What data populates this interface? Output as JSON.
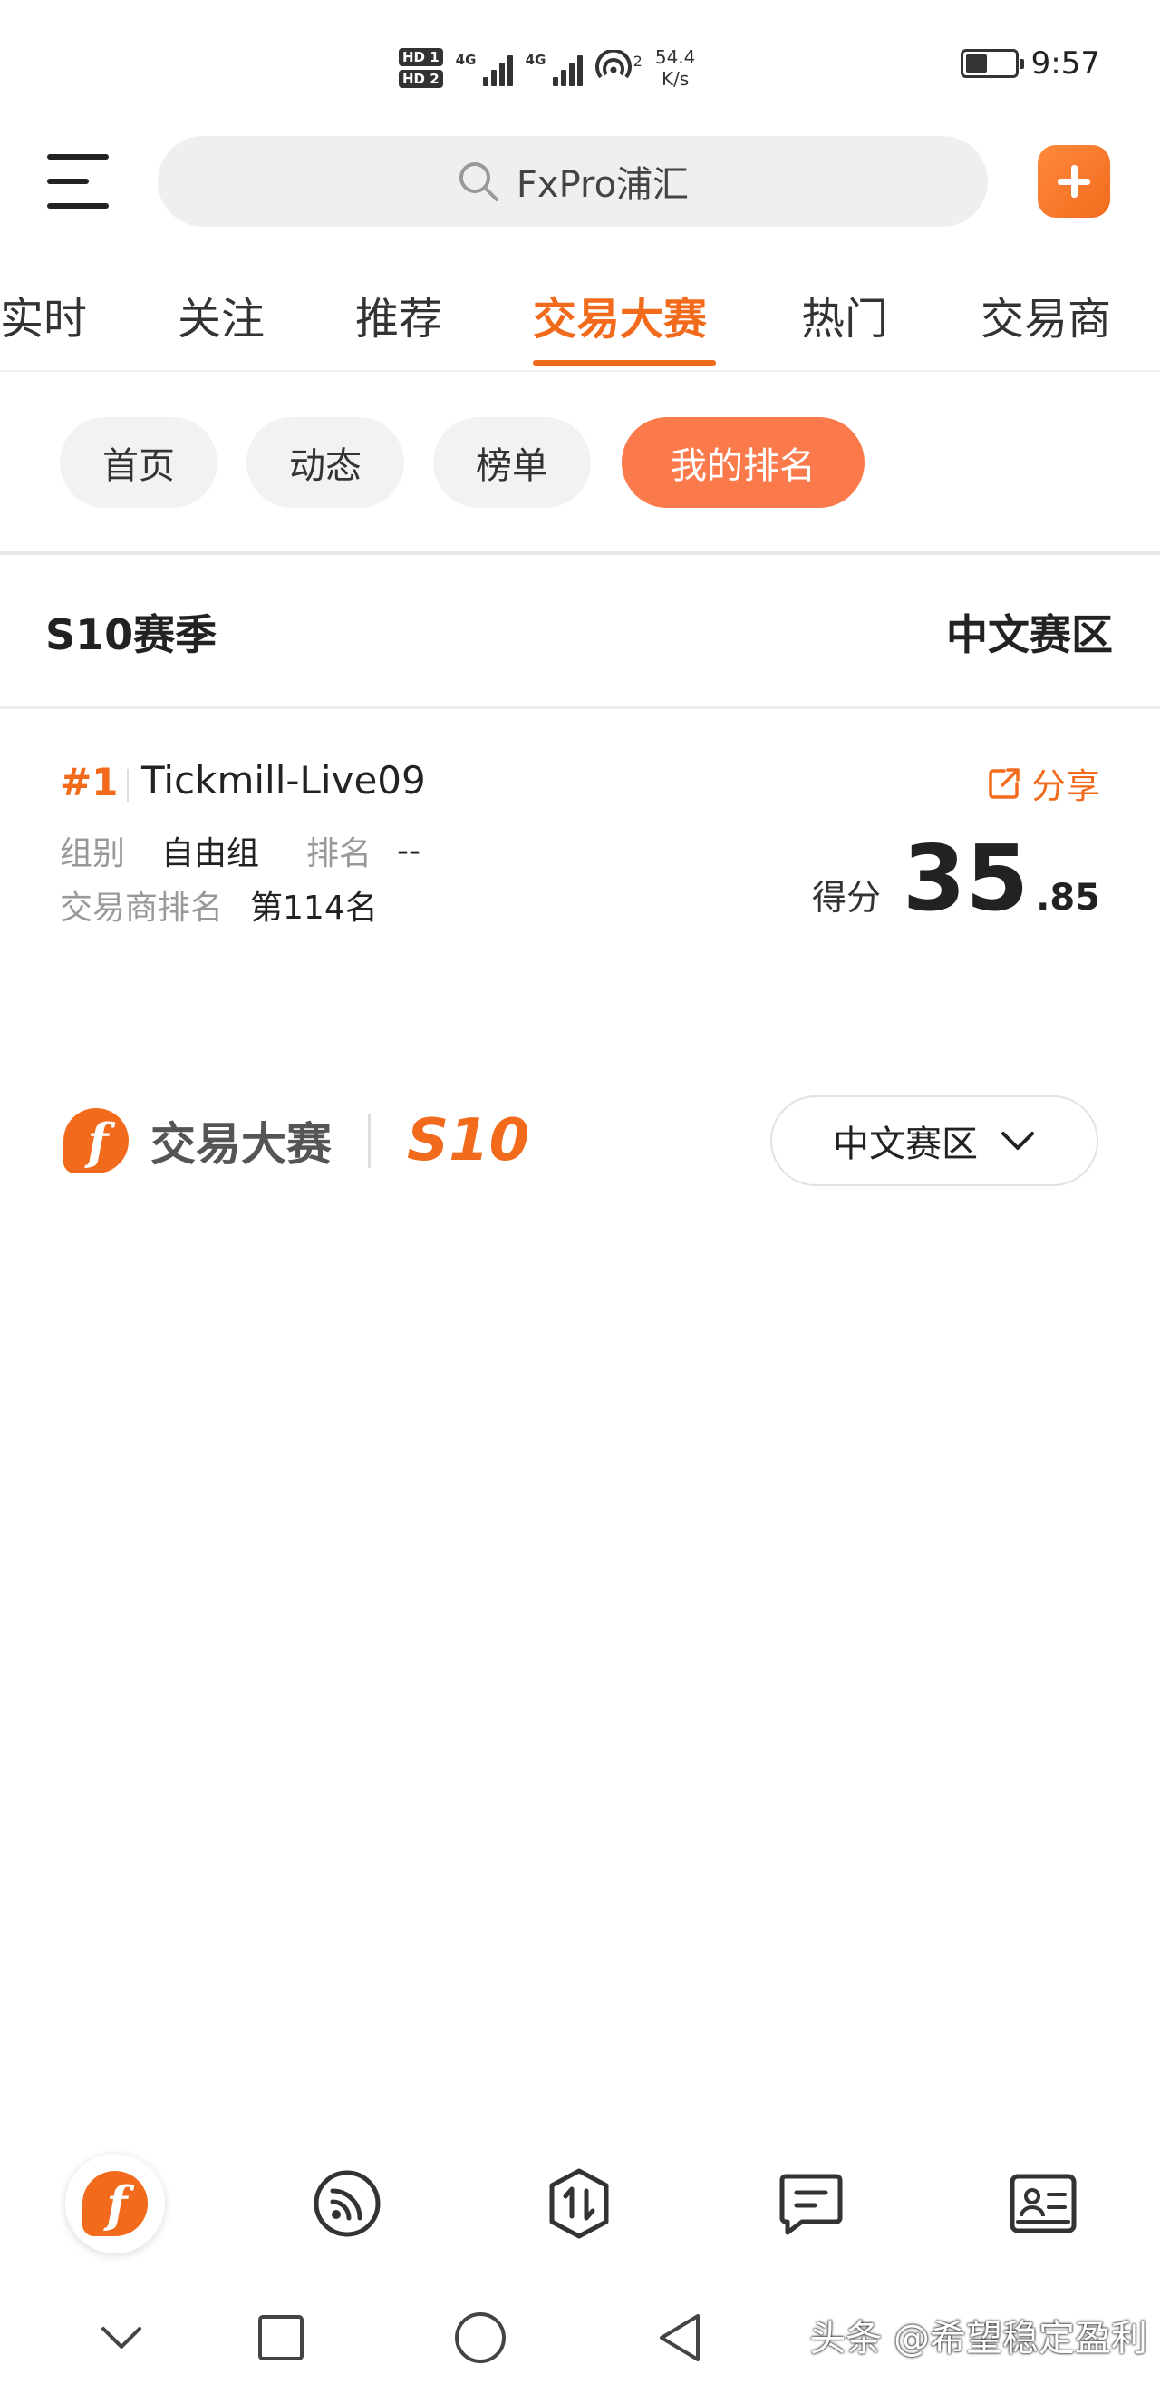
{
  "status_bar": {
    "hd1": "HD 1",
    "hd2": "HD 2",
    "net1": "4G",
    "net2": "4G",
    "wifi_badge": "2",
    "speed_value": "54.4",
    "speed_unit": "K/s",
    "time": "9:57",
    "battery_level_percent": 45
  },
  "search": {
    "text": "FxPro浦汇"
  },
  "tabs": [
    {
      "label": "实时"
    },
    {
      "label": "关注"
    },
    {
      "label": "推荐"
    },
    {
      "label": "交易大赛",
      "active": true
    },
    {
      "label": "热门"
    },
    {
      "label": "交易商"
    }
  ],
  "chips": [
    {
      "label": "首页"
    },
    {
      "label": "动态"
    },
    {
      "label": "榜单"
    },
    {
      "label": "我的排名",
      "active": true
    }
  ],
  "season": {
    "title": "S10赛季",
    "region": "中文赛区"
  },
  "rank_card": {
    "rank": "#1",
    "account": "Tickmill-Live09",
    "share_label": "分享",
    "group_key": "组别",
    "group_value": "自由组",
    "rank_key": "排名",
    "rank_value": "--",
    "broker_rank_key": "交易商排名",
    "broker_rank_value": "第114名",
    "score_label": "得分",
    "score_int": "35",
    "score_dec": ".85"
  },
  "brand": {
    "logo_letter": "f",
    "text": "交易大赛",
    "season": "S10",
    "region_select": "中文赛区"
  },
  "watermark": "头条 @希望稳定盈利",
  "colors": {
    "accent": "#f26b1d",
    "chip_active": "#fa7a4c"
  }
}
